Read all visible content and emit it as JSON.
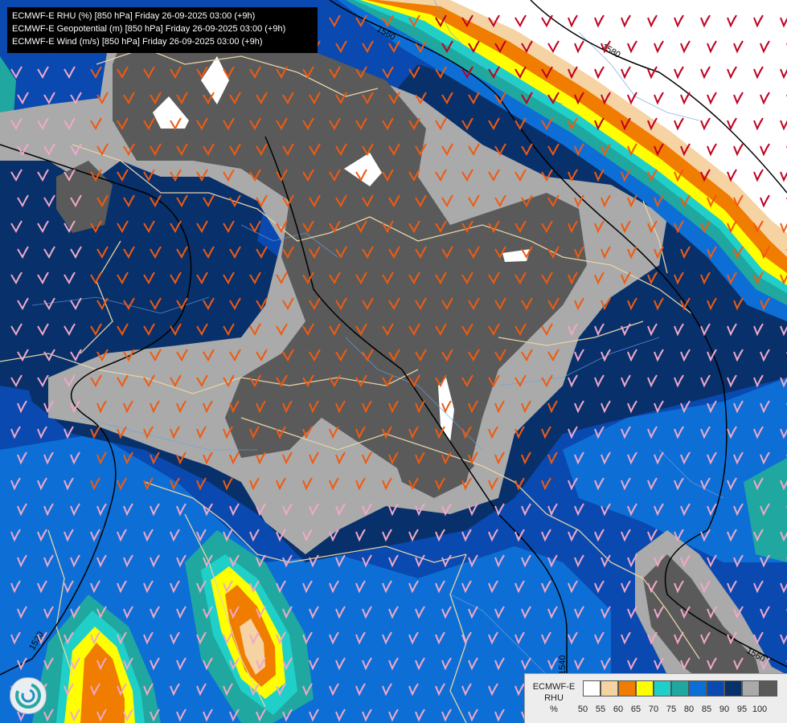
{
  "header": {
    "lines": [
      "ECMWF-E RHU (%) [850 hPa] Friday 26-09-2025 03:00 (+9h)",
      "ECMWF-E Geopotential (m) [850 hPa] Friday 26-09-2025 03:00 (+9h)",
      "ECMWF-E Wind (m/s) [850 hPa] Friday 26-09-2025 03:00 (+9h)"
    ]
  },
  "contour_labels": [
    "1560",
    "1580",
    "1520",
    "1540",
    "1560"
  ],
  "legend": {
    "model": "ECMWF-E",
    "variable": "RHU",
    "unit": "%",
    "ticks": [
      "50",
      "55",
      "60",
      "65",
      "70",
      "75",
      "80",
      "85",
      "90",
      "95",
      "100"
    ],
    "colors": [
      "#ffffff",
      "#f5d3a3",
      "#f07c00",
      "#ffff00",
      "#20d0c8",
      "#20a8a0",
      "#0d6fd6",
      "#0a49b0",
      "#08306b",
      "#aaaaaa",
      "#5a5a5a"
    ]
  },
  "colors": {
    "grey_dark": "#5a5a5a",
    "grey_light": "#aaaaaa",
    "blue_dark": "#08306b",
    "blue_mid": "#0a49b0",
    "blue_light": "#0d6fd6",
    "teal": "#20a8a0",
    "cyan": "#20d0c8",
    "yellow": "#ffff00",
    "orange": "#f07c00",
    "peach": "#f5d3a3",
    "border": "#e6d2a6",
    "river": "#6aa0e0",
    "barb_orange": "#f05a10",
    "barb_pink": "#f0a8c8",
    "barb_red": "#c00020",
    "contour": "#000000"
  },
  "logo_icon": "ecmwf-swirl-icon"
}
